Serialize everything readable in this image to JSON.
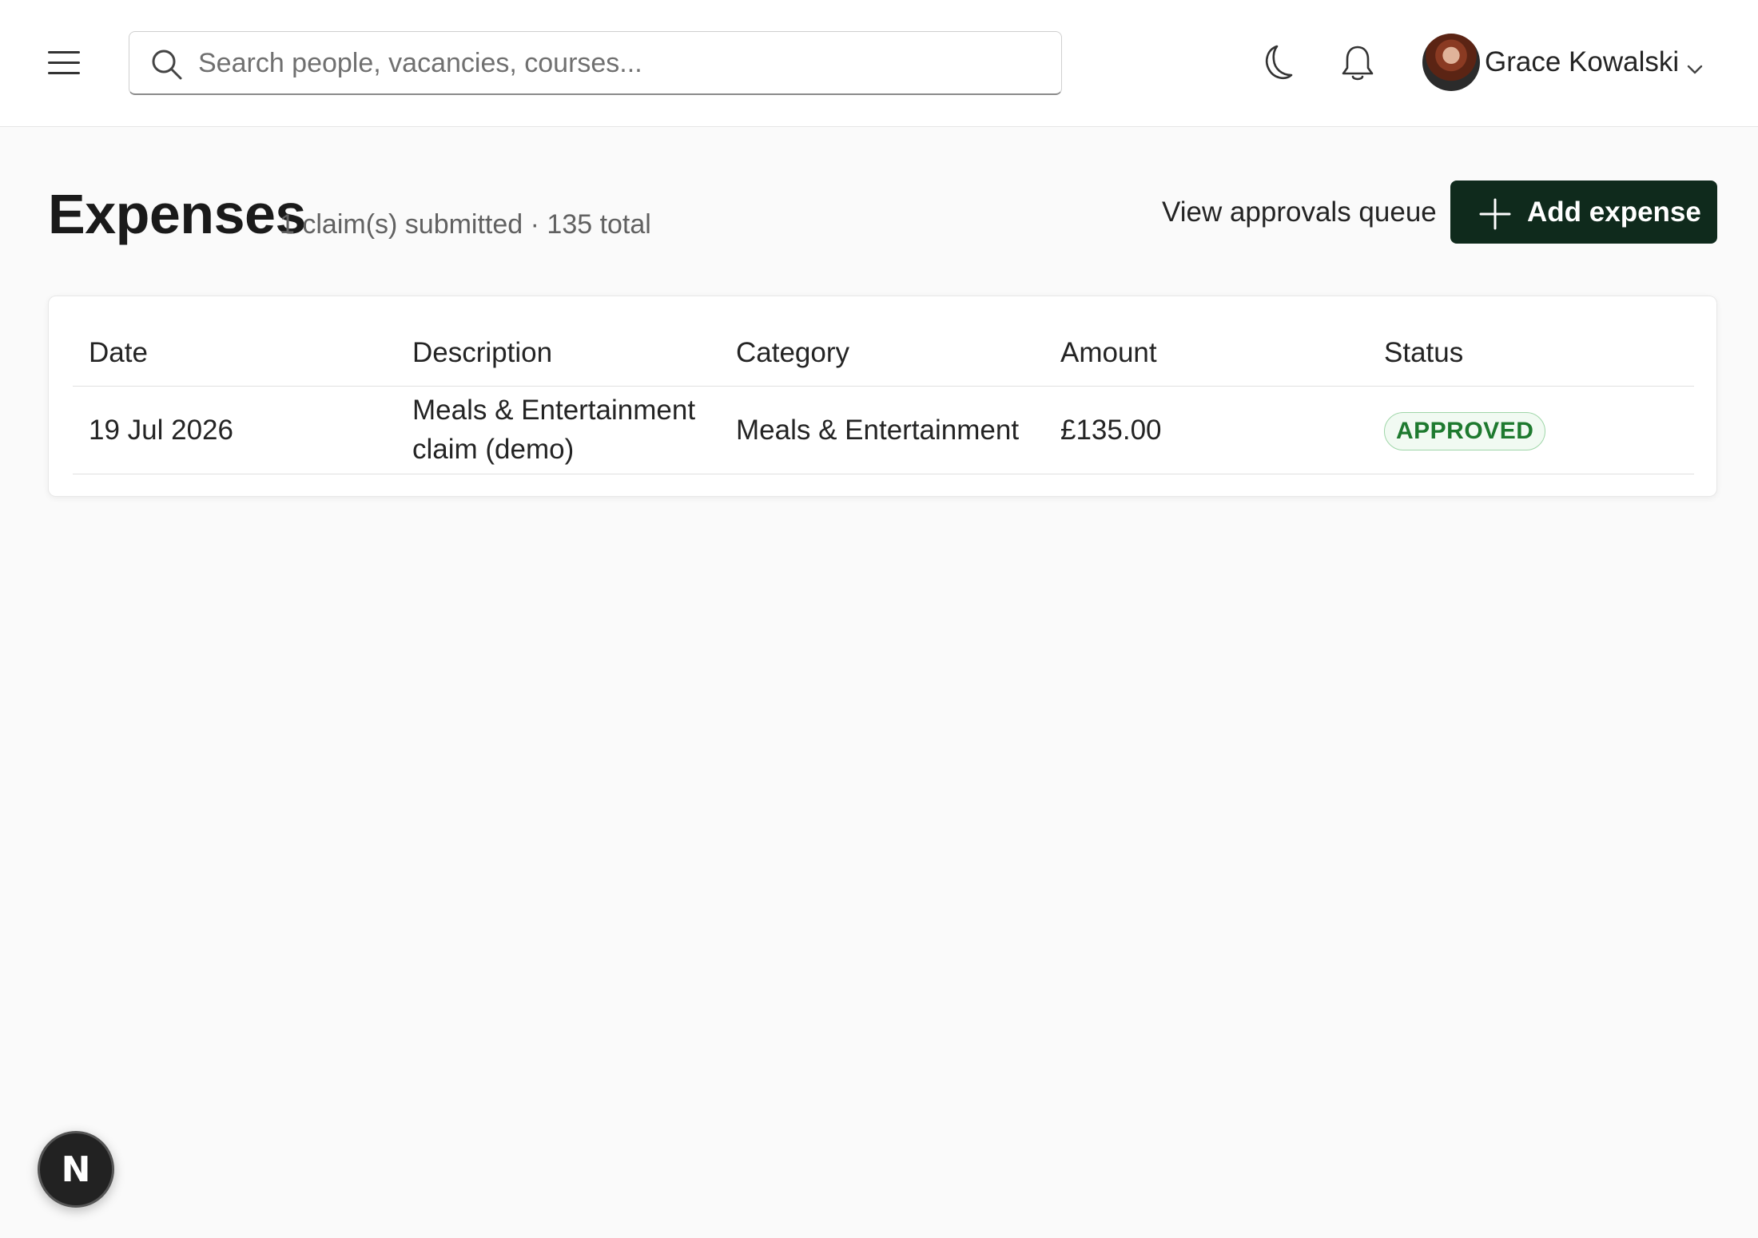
{
  "header": {
    "search_placeholder": "Search people, vacancies, courses...",
    "user_name": "Grace Kowalski"
  },
  "page": {
    "title": "Expenses",
    "subtitle": "1 claim(s) submitted · 135 total",
    "approvals_link": "View approvals queue",
    "add_button_label": "Add expense"
  },
  "table": {
    "columns": [
      "Date",
      "Description",
      "Category",
      "Amount",
      "Status"
    ],
    "rows": [
      {
        "date": "19 Jul 2026",
        "description": "Meals & Entertainment claim (demo)",
        "category": "Meals & Entertainment",
        "amount": "£135.00",
        "status": "APPROVED"
      }
    ]
  },
  "fab": {
    "label": "N"
  },
  "colors": {
    "primary_button": "#0f2a1c",
    "status_approved": "#1e7a2f"
  }
}
